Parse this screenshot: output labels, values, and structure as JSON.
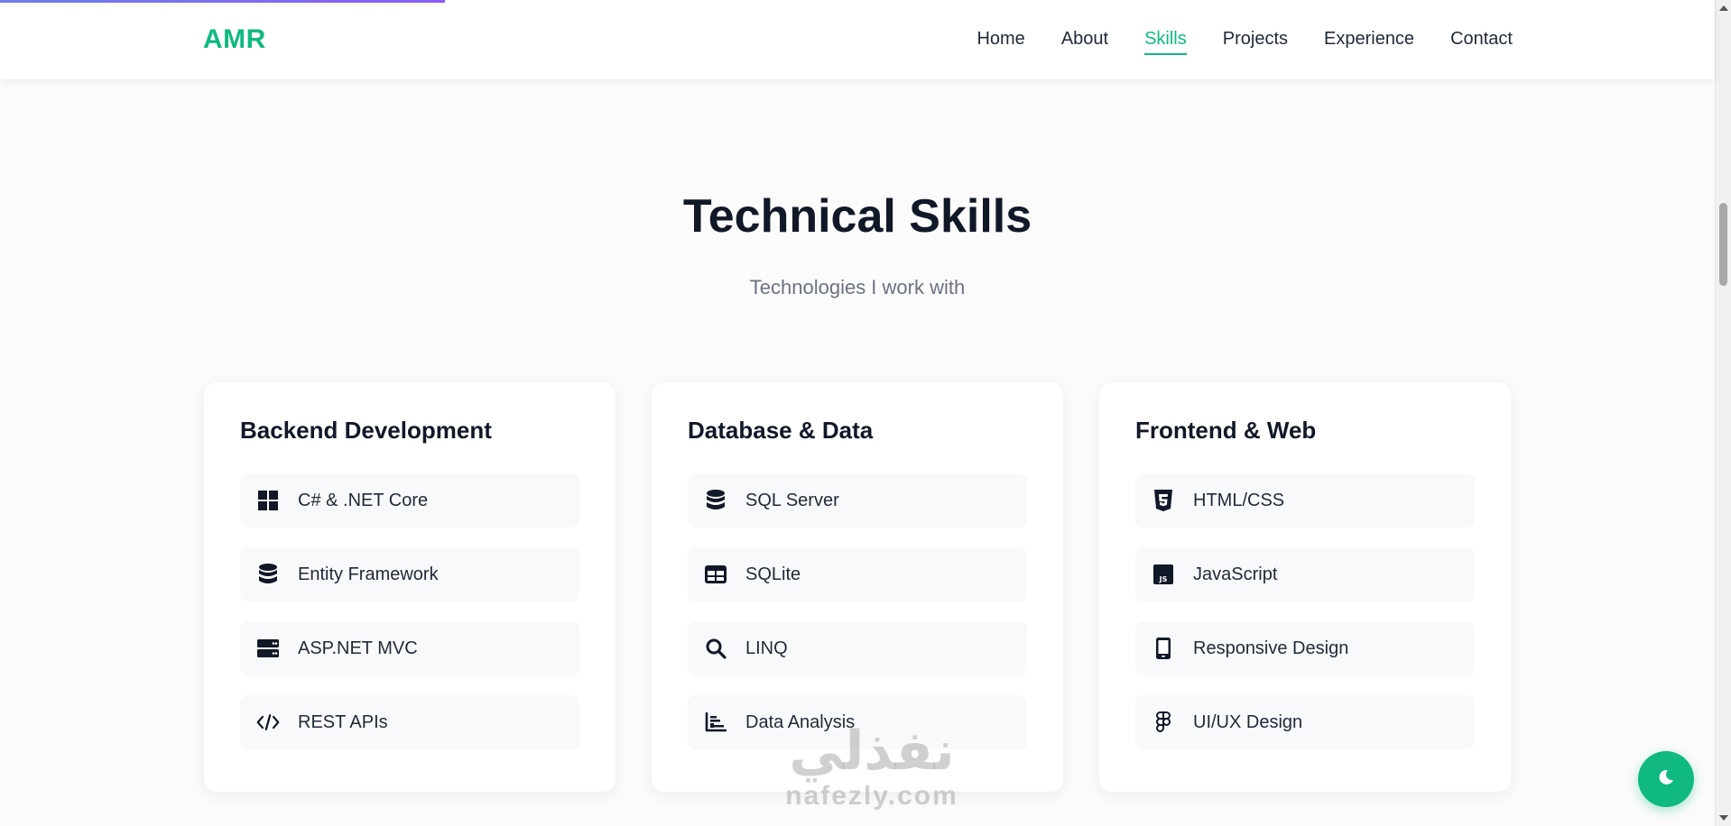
{
  "header": {
    "logo": "AMR",
    "nav": [
      {
        "label": "Home"
      },
      {
        "label": "About"
      },
      {
        "label": "Skills",
        "active": true
      },
      {
        "label": "Projects"
      },
      {
        "label": "Experience"
      },
      {
        "label": "Contact"
      }
    ]
  },
  "skills_section": {
    "title": "Technical Skills",
    "subtitle": "Technologies I work with",
    "cards": [
      {
        "title": "Backend Development",
        "items": [
          {
            "label": "C# & .NET Core",
            "icon": "windows-icon"
          },
          {
            "label": "Entity Framework",
            "icon": "database-icon"
          },
          {
            "label": "ASP.NET MVC",
            "icon": "server-icon"
          },
          {
            "label": "REST APIs",
            "icon": "code-icon"
          }
        ]
      },
      {
        "title": "Database & Data",
        "items": [
          {
            "label": "SQL Server",
            "icon": "database-icon"
          },
          {
            "label": "SQLite",
            "icon": "table-icon"
          },
          {
            "label": "LINQ",
            "icon": "search-icon"
          },
          {
            "label": "Data Analysis",
            "icon": "chart-bar-icon"
          }
        ]
      },
      {
        "title": "Frontend & Web",
        "items": [
          {
            "label": "HTML/CSS",
            "icon": "html5-icon"
          },
          {
            "label": "JavaScript",
            "icon": "js-icon"
          },
          {
            "label": "Responsive Design",
            "icon": "mobile-icon"
          },
          {
            "label": "UI/UX Design",
            "icon": "figma-icon"
          }
        ]
      }
    ]
  },
  "watermark": {
    "arabic": "نفذلي",
    "latin": "nafezly.com"
  },
  "theme_toggle": {
    "icon": "moon-icon"
  },
  "colors": {
    "accent": "#10b981",
    "text": "#111827",
    "muted": "#6b7280"
  }
}
